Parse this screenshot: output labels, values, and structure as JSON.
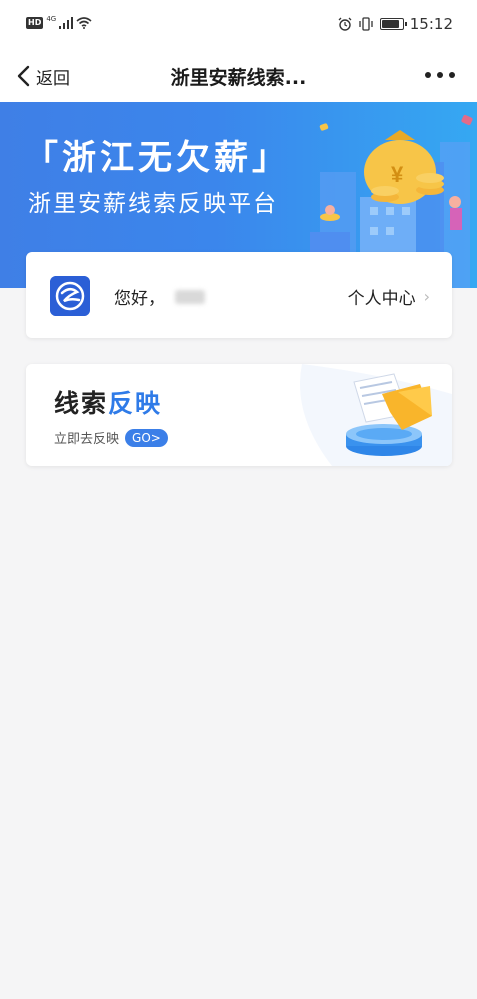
{
  "status_bar": {
    "hd": "HD",
    "network": "4G",
    "time": "15:12",
    "battery_level": 0.8
  },
  "nav": {
    "back_label": "返回",
    "title": "浙里安薪线索...",
    "more_icon": "more-icon"
  },
  "banner": {
    "title": "「浙江无欠薪」",
    "subtitle": "浙里安薪线索反映平台",
    "colors": {
      "start": "#3f7fe6",
      "end": "#35a8f2"
    }
  },
  "user_card": {
    "greeting": "您好，",
    "profile_link": "个人中心"
  },
  "report_card": {
    "title_part1": "线索",
    "title_part2": "反映",
    "subtitle": "立即去反映",
    "go_label": "GO>",
    "accent": "#2f7be8"
  }
}
